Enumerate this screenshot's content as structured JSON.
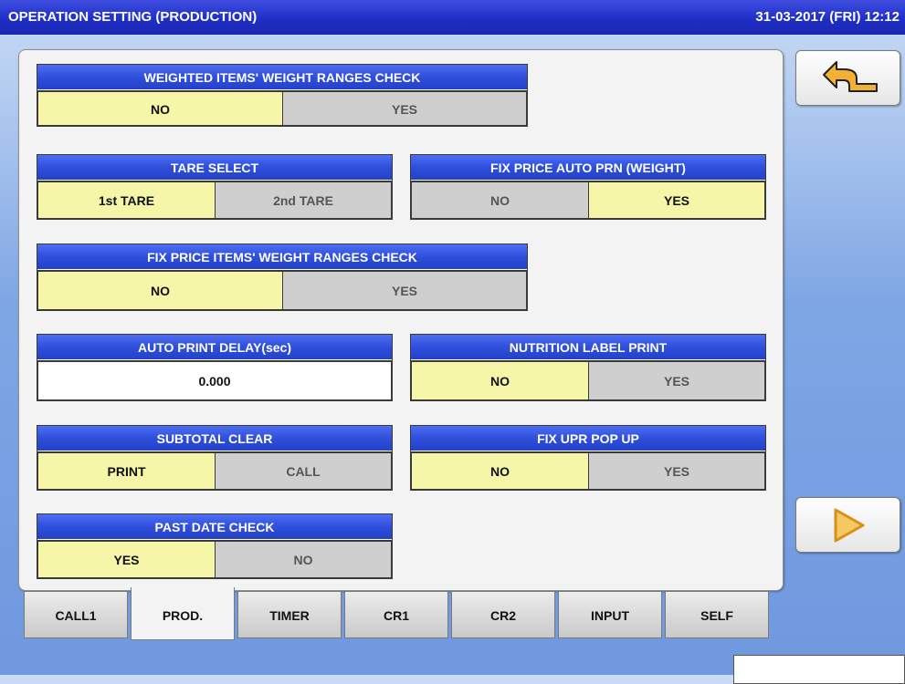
{
  "header": {
    "title": "OPERATION SETTING (PRODUCTION)",
    "datetime": "31-03-2017 (FRI)  12:12"
  },
  "settings": {
    "weighted_check": {
      "label": "WEIGHTED ITEMS' WEIGHT RANGES CHECK",
      "opt1": "NO",
      "opt2": "YES",
      "selected": "NO"
    },
    "tare_select": {
      "label": "TARE SELECT",
      "opt1": "1st TARE",
      "opt2": "2nd TARE",
      "selected": "1st TARE"
    },
    "fix_price_auto_prn": {
      "label": "FIX PRICE AUTO PRN (WEIGHT)",
      "opt1": "NO",
      "opt2": "YES",
      "selected": "YES"
    },
    "fix_price_check": {
      "label": "FIX PRICE ITEMS' WEIGHT RANGES CHECK",
      "opt1": "NO",
      "opt2": "YES",
      "selected": "NO"
    },
    "auto_print_delay": {
      "label": "AUTO PRINT DELAY(sec)",
      "value": "0.000"
    },
    "nutrition_label": {
      "label": "NUTRITION LABEL PRINT",
      "opt1": "NO",
      "opt2": "YES",
      "selected": "NO"
    },
    "subtotal_clear": {
      "label": "SUBTOTAL CLEAR",
      "opt1": "PRINT",
      "opt2": "CALL",
      "selected": "PRINT"
    },
    "fix_upr_popup": {
      "label": "FIX UPR POP UP",
      "opt1": "NO",
      "opt2": "YES",
      "selected": "NO"
    },
    "past_date_check": {
      "label": "PAST DATE CHECK",
      "opt1": "YES",
      "opt2": "NO",
      "selected": "YES"
    }
  },
  "tabs": [
    "CALL1",
    "PROD.",
    "TIMER",
    "CR1",
    "CR2",
    "INPUT",
    "SELF"
  ],
  "active_tab": "PROD.",
  "icons": {
    "back": "return-arrow-icon",
    "next": "play-arrow-icon"
  },
  "colors": {
    "header_blue": "#2441c8",
    "selected_yellow": "#f6f6a8",
    "unselected_gray": "#cfcfcf",
    "icon_orange": "#f2a51f"
  }
}
